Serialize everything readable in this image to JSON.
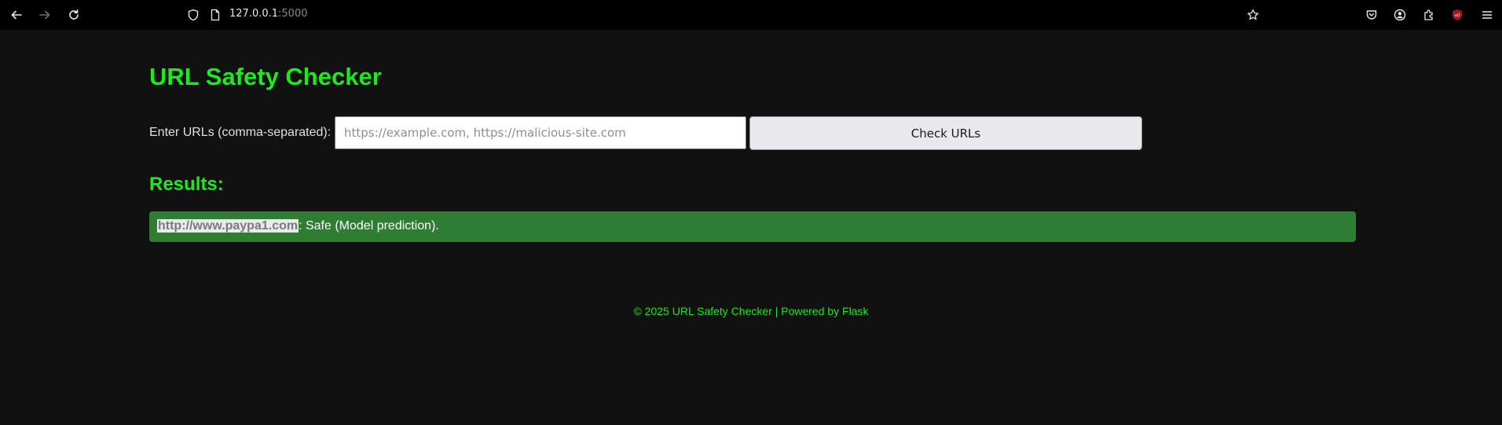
{
  "browser": {
    "url_host": "127.0.0.1",
    "url_port": ":5000"
  },
  "page": {
    "title": "URL Safety Checker",
    "form": {
      "label": "Enter URLs (comma-separated):",
      "input_value": "",
      "input_placeholder": "https://example.com, https://malicious-site.com",
      "submit_label": "Check URLs"
    },
    "results": {
      "heading": "Results:",
      "items": [
        {
          "url": "http://www.paypa1.com",
          "status": ": Safe (Model prediction)."
        }
      ]
    },
    "footer": "© 2025 URL Safety Checker | Powered by Flask"
  },
  "colors": {
    "accent_green": "#1ee81e",
    "safe_result_bg": "#2e7d32",
    "page_bg": "#111111"
  },
  "icons": [
    "back-icon",
    "forward-icon",
    "reload-icon",
    "shield-icon",
    "page-icon",
    "star-icon",
    "pocket-icon",
    "account-icon",
    "extensions-icon",
    "ublock-icon",
    "menu-icon"
  ]
}
